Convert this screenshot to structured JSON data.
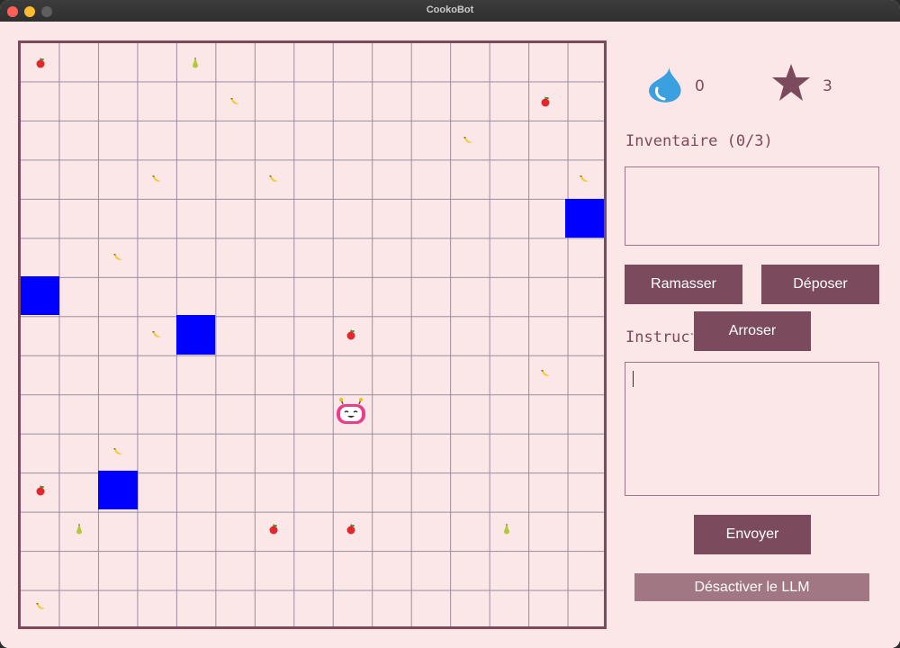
{
  "window": {
    "title": "CookoBot"
  },
  "colors": {
    "accent": "#7b4a5c",
    "accent_light": "#a27784",
    "background": "#fbe7e8",
    "water_tile": "#0000ff",
    "drop_icon": "#3aa0e0"
  },
  "grid": {
    "columns": 15,
    "rows": 15,
    "water_tiles": [
      {
        "col": 14,
        "row": 4
      },
      {
        "col": 0,
        "row": 6
      },
      {
        "col": 4,
        "row": 7
      },
      {
        "col": 2,
        "row": 11
      }
    ],
    "items": [
      {
        "type": "apple",
        "col": 0,
        "row": 0
      },
      {
        "type": "pear",
        "col": 4,
        "row": 0
      },
      {
        "type": "banana",
        "col": 5,
        "row": 1
      },
      {
        "type": "apple",
        "col": 13,
        "row": 1
      },
      {
        "type": "banana",
        "col": 11,
        "row": 2
      },
      {
        "type": "banana",
        "col": 3,
        "row": 3
      },
      {
        "type": "banana",
        "col": 6,
        "row": 3
      },
      {
        "type": "banana",
        "col": 14,
        "row": 3
      },
      {
        "type": "banana",
        "col": 2,
        "row": 5
      },
      {
        "type": "banana",
        "col": 3,
        "row": 7
      },
      {
        "type": "apple",
        "col": 8,
        "row": 7
      },
      {
        "type": "banana",
        "col": 13,
        "row": 8
      },
      {
        "type": "banana",
        "col": 2,
        "row": 10
      },
      {
        "type": "apple",
        "col": 0,
        "row": 11
      },
      {
        "type": "pear",
        "col": 1,
        "row": 12
      },
      {
        "type": "apple",
        "col": 6,
        "row": 12
      },
      {
        "type": "apple",
        "col": 8,
        "row": 12
      },
      {
        "type": "pear",
        "col": 12,
        "row": 12
      },
      {
        "type": "banana",
        "col": 0,
        "row": 14
      }
    ],
    "robot": {
      "col": 8,
      "row": 9
    }
  },
  "stats": {
    "water_icon": "water-drop-icon",
    "water_count": "0",
    "star_icon": "star-icon",
    "star_count": "3"
  },
  "inventory": {
    "label": "Inventaire (0/3)",
    "contents": ""
  },
  "buttons": {
    "pick_up": "Ramasser",
    "drop": "Déposer",
    "water": "Arroser",
    "send": "Envoyer",
    "toggle_llm": "Désactiver le LLM"
  },
  "instructions": {
    "label": "Instructions",
    "value": ""
  }
}
